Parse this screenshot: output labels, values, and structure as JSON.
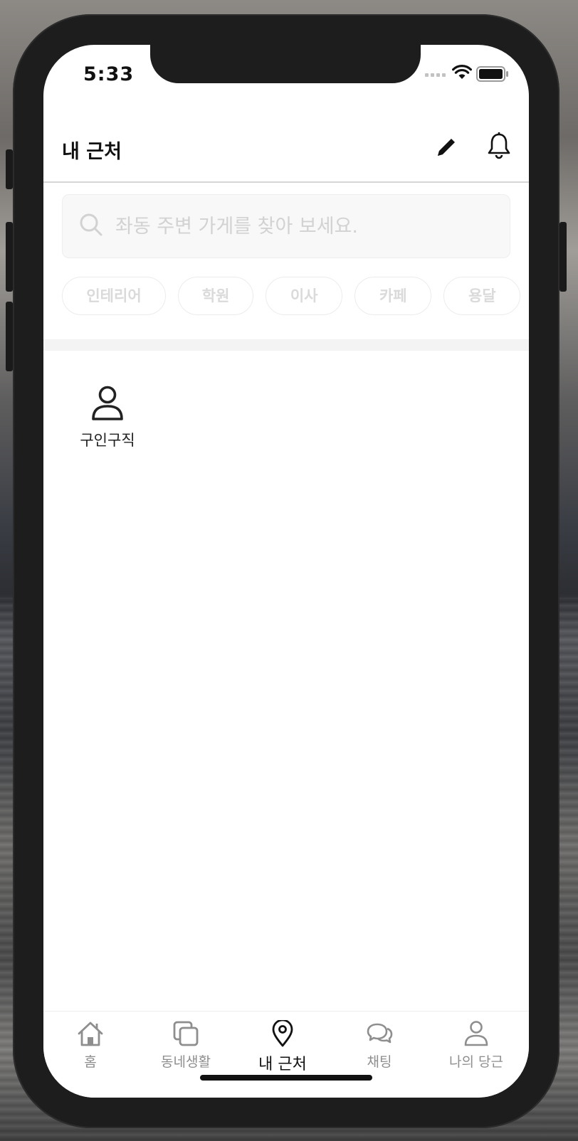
{
  "status_bar": {
    "time": "5:33"
  },
  "header": {
    "title": "내 근처",
    "edit_icon": "pencil-icon",
    "notification_icon": "bell-icon"
  },
  "search": {
    "placeholder": "좌동 주변 가게를 찾아 보세요.",
    "icon": "search-icon"
  },
  "categories": [
    "인테리어",
    "학원",
    "이사",
    "카페",
    "용달"
  ],
  "shortcuts": [
    {
      "label": "구인구직",
      "icon": "person-icon"
    }
  ],
  "tabbar": {
    "items": [
      {
        "label": "홈",
        "icon": "home-icon",
        "active": false
      },
      {
        "label": "동네생활",
        "icon": "copy-icon",
        "active": false
      },
      {
        "label": "내 근처",
        "icon": "location-pin-icon",
        "active": true
      },
      {
        "label": "채팅",
        "icon": "chat-icon",
        "active": false
      },
      {
        "label": "나의 당근",
        "icon": "person-icon",
        "active": false
      }
    ]
  },
  "colors": {
    "active_tab": "#111111",
    "inactive_tab": "#8e8e8e",
    "chip_text": "#dadada",
    "search_bg": "#f8f8f8"
  }
}
